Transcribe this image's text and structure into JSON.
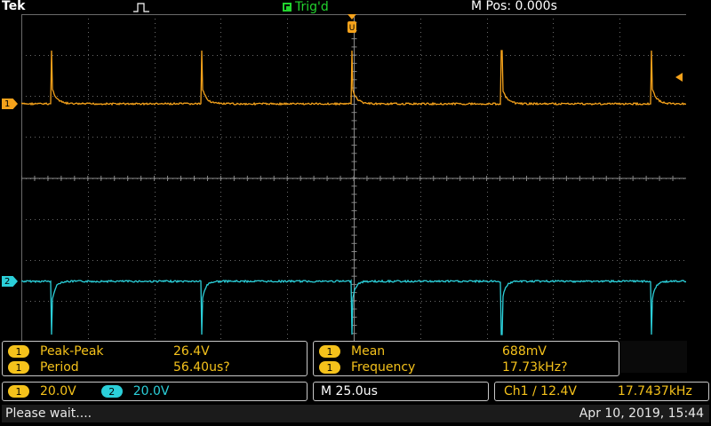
{
  "header": {
    "brand": "Tek",
    "trigger_state": "Trig'd",
    "horizontal_position": "M Pos: 0.000s"
  },
  "channels": {
    "ch1": {
      "number": "1",
      "color": "#f5a21b"
    },
    "ch2": {
      "number": "2",
      "color": "#2bcfd9"
    }
  },
  "measurements": {
    "left": [
      {
        "channel": "1",
        "label": "Peak-Peak",
        "value": "26.4V"
      },
      {
        "channel": "1",
        "label": "Period",
        "value": "56.40us?"
      }
    ],
    "right": [
      {
        "channel": "1",
        "label": "Mean",
        "value": "688mV"
      },
      {
        "channel": "1",
        "label": "Frequency",
        "value": "17.73kHz?"
      }
    ]
  },
  "status": {
    "ch1_scale": "20.0V",
    "ch2_scale": "20.0V",
    "timebase": "M 25.0us",
    "trigger_setting": "Ch1 ∕ 12.4V",
    "trigger_frequency": "17.7437kHz"
  },
  "footer": {
    "message": "Please wait....",
    "datetime": "Apr 10, 2019, 15:44"
  },
  "waveform": {
    "period_divs": 2.256,
    "first_edge_div": 1.0,
    "time_per_div_label": "M 25.0us"
  }
}
